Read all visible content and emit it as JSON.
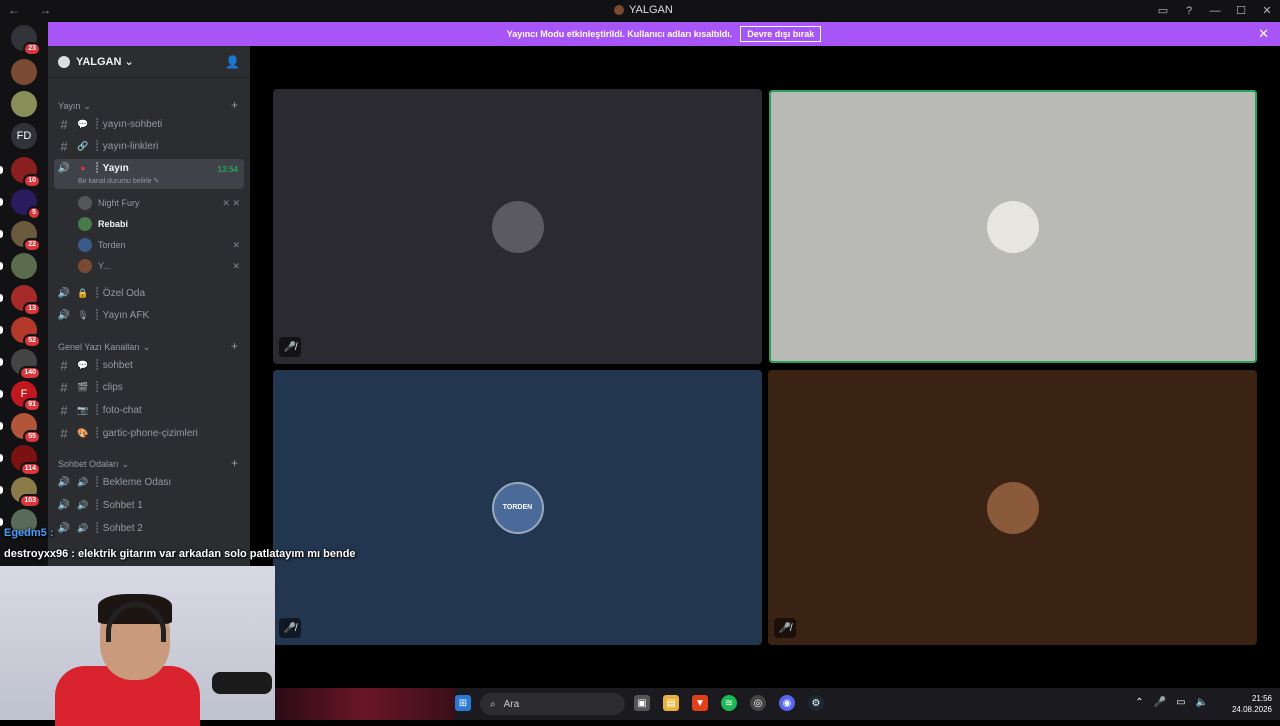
{
  "window": {
    "title": "YALGAN",
    "nav": "← →",
    "controls": [
      "▭",
      "?",
      "—",
      "☐",
      "✕"
    ]
  },
  "banner": {
    "text": "Yayıncı Modu etkinleştirildi. Kullanıcı adları kısaltıldı.",
    "button": "Devre dışı bırak",
    "close": "✕"
  },
  "servers": [
    {
      "label": "",
      "badge": "23",
      "color": "#313338"
    },
    {
      "label": "",
      "badge": "",
      "color": "#7a4a32"
    },
    {
      "label": "",
      "badge": "",
      "color": "#8a8f5a"
    },
    {
      "label": "FD",
      "badge": "",
      "color": "#313338"
    },
    {
      "label": "",
      "badge": "10",
      "color": "#8a1f1f"
    },
    {
      "label": "",
      "badge": "5",
      "color": "#2a1a5e"
    },
    {
      "label": "",
      "badge": "22",
      "color": "#6b5a3e"
    },
    {
      "label": "",
      "badge": "",
      "color": "#5a6b4e"
    },
    {
      "label": "",
      "badge": "13",
      "color": "#a52a2a"
    },
    {
      "label": "",
      "badge": "52",
      "color": "#b33a2a"
    },
    {
      "label": "",
      "badge": "140",
      "color": "#444"
    },
    {
      "label": "F",
      "badge": "91",
      "color": "#c0181e"
    },
    {
      "label": "",
      "badge": "55",
      "color": "#b0543a"
    },
    {
      "label": "",
      "badge": "114",
      "color": "#7a1212"
    },
    {
      "label": "",
      "badge": "103",
      "color": "#8a7a4a"
    },
    {
      "label": "",
      "badge": "",
      "color": "#5a6a5a"
    }
  ],
  "sidebar": {
    "server_name": "YALGAN",
    "categories": {
      "yayin": "Yayın",
      "genel": "Genel Yazı Kanalları",
      "sohbet": "Sohbet Odaları"
    },
    "channels": {
      "yayin_sohbeti": "┊ yayın-sohbeti",
      "yayin_linkleri": "┊ yayın-linkleri",
      "yayin_voice": "┊ Yayın",
      "yayin_time": "13:54",
      "yayin_status": "Bir kanal durumu belirle ✎",
      "ozel_oda": "┊ Özel Oda",
      "yayin_afk": "┊ Yayın AFK",
      "sohbet": "┊ sohbet",
      "clips": "┊ clips",
      "foto_chat": "┊ foto-chat",
      "gartic": "┊ gartic-phone-çizimleri",
      "bekleme": "┊ Bekleme Odası",
      "sohbet1": "┊ Sohbet 1",
      "sohbet2": "┊ Sohbet 2"
    },
    "voice_users": [
      {
        "name": "Night Fury",
        "color": "#555"
      },
      {
        "name": "Rebabi",
        "color": "#4a7a4a"
      },
      {
        "name": "Torden",
        "color": "#3a5a8a"
      },
      {
        "name": "Y...",
        "color": "#7a4a32"
      }
    ]
  },
  "chat_overlay": {
    "line1": "Egedm5 :",
    "line2": "destroyxx96 : elektrik gitarım var arkadan solo patlatayım mı bende"
  },
  "tiles": [
    {
      "bg": "#2b2a30",
      "avatar": "#5a5a60",
      "muted": true
    },
    {
      "bg": "#b9bab5",
      "avatar": "#e8e6e0",
      "muted": false,
      "speaking": true
    },
    {
      "bg": "#233650",
      "avatar": "#4a6a9a",
      "muted": true,
      "avatar_text": "TORDEN"
    },
    {
      "bg": "#3b2314",
      "avatar": "#8a5a3a",
      "muted": true
    }
  ],
  "taskbar": {
    "search": "Ara",
    "time": "21:56",
    "date": "24.08.2026"
  }
}
